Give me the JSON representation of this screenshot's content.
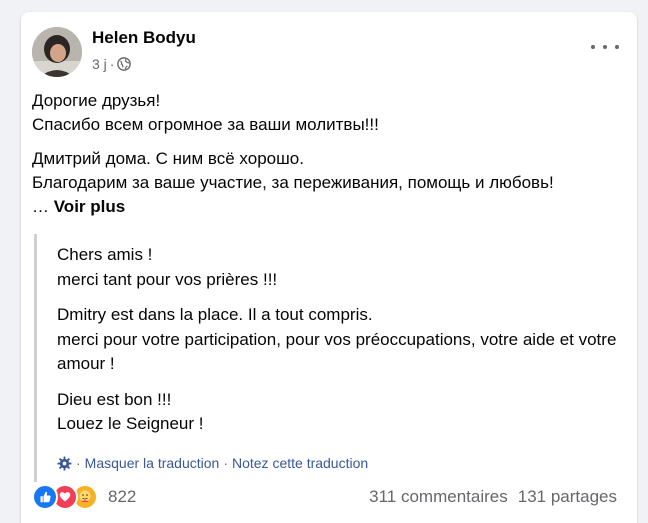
{
  "post": {
    "author": "Helen Bodyu",
    "time": "3 j",
    "time_separator": "·",
    "text": {
      "p1_line1": "Дорогие друзья!",
      "p1_line2": "Спасибо всем огромное за ваши молитвы!!!",
      "p2_line1": "Дмитрий дома. С ним всё хорошо.",
      "p2_line2": "Благодарим за ваше участие, за переживания, помощь и любовь!",
      "ellipsis": "… ",
      "see_more": "Voir plus"
    },
    "translation": {
      "p1_line1": "Chers amis !",
      "p1_line2": "merci tant pour vos prières !!!",
      "p2_line1": "Dmitry est dans la place. Il a tout compris.",
      "p2_line2": "merci pour votre participation, pour vos préoccupations, votre aide et votre amour !",
      "p3_line1": "Dieu est bon !!!",
      "p3_line2": "Louez le Seigneur !",
      "hide_label": "Masquer la traduction",
      "rate_label": "Notez cette traduction",
      "separator": "·"
    },
    "footer": {
      "reaction_count": "822",
      "comments": "311 commentaires",
      "shares": "131 partages"
    },
    "icons": {
      "privacy": "globe-icon",
      "more": "more-options-icon",
      "settings": "gear-icon",
      "reactions": [
        "like-icon",
        "love-icon",
        "care-icon"
      ]
    },
    "colors": {
      "link": "#385898",
      "secondary_text": "#65676b",
      "like": "#1877f2",
      "love": "#f33e58",
      "care": "#f7b125"
    }
  }
}
